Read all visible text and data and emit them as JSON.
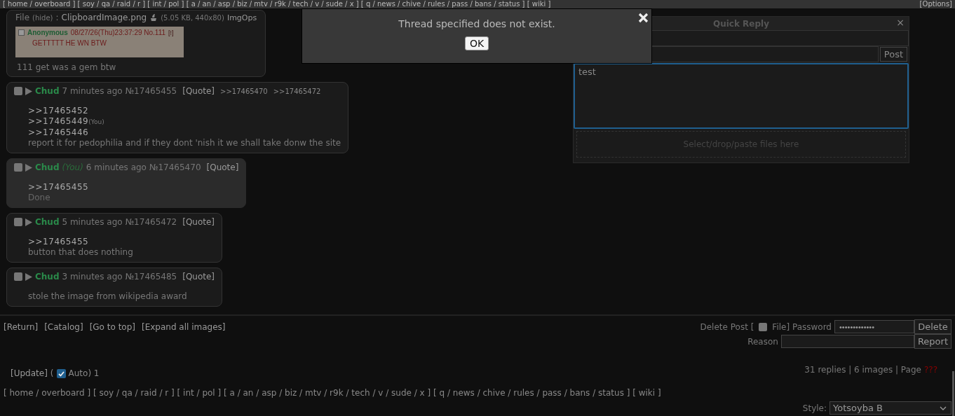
{
  "top_nav": {
    "boards": "[ home / overboard ] [ soy / qa / raid / r ] [ int / pol ] [ a / an / asp / biz / mtv / r9k / tech / v / sude / x ] [ q / news / chive / rules / pass / bans / status ] [ wiki ]",
    "options": "[Options]"
  },
  "first_post": {
    "file_label": "File",
    "hide": "(hide)",
    "colon": ":",
    "filename": "ClipboardImage.png",
    "file_meta": "(5.05 KB, 440x80)",
    "imgops": "ImgOps",
    "thumbnail": {
      "name": "Anonymous",
      "date": "08/27/26(Thu)23:37:29 No.111",
      "flag": "[!]",
      "body": "GETTTTT HE WN BTW"
    },
    "body": "111 get was a gem btw"
  },
  "posts": [
    {
      "name": "Chud",
      "highlighted": false,
      "checked": false,
      "time": "7 minutes ago",
      "number": "№17465455",
      "quote": "[Quote]",
      "backlinks": [
        ">>17465470",
        ">>17465472"
      ],
      "lines": [
        {
          "kind": "quote",
          "text": ">>17465452"
        },
        {
          "kind": "quote",
          "text": ">>17465449",
          "you": "(You)"
        },
        {
          "kind": "quote",
          "text": ">>17465446"
        },
        {
          "kind": "text",
          "text": "report it for pedophilia and if they dont 'nish it we shall take donw the site"
        }
      ]
    },
    {
      "name": "Chud",
      "you": "(You)",
      "highlighted": true,
      "checked": false,
      "time": "6 minutes ago",
      "number": "№17465470",
      "quote": "[Quote]",
      "lines": [
        {
          "kind": "quote",
          "text": ">>17465455"
        },
        {
          "kind": "text",
          "text": "Done"
        }
      ]
    },
    {
      "name": "Chud",
      "highlighted": false,
      "checked": false,
      "time": "5 minutes ago",
      "number": "№17465472",
      "quote": "[Quote]",
      "lines": [
        {
          "kind": "quote",
          "text": ">>17465455"
        },
        {
          "kind": "text",
          "text": "button that does nothing"
        }
      ]
    },
    {
      "name": "Chud",
      "highlighted": false,
      "checked": false,
      "time": "3 minutes ago",
      "number": "№17465485",
      "quote": "[Quote]",
      "lines": [
        {
          "kind": "text",
          "text": "stole the image from wikipedia award"
        }
      ]
    }
  ],
  "footer_links": [
    "[Return]",
    "[Catalog]",
    "[Go to top]",
    "[Expand all images]"
  ],
  "delete_form": {
    "delete_label": "Delete Post [",
    "file_checked": false,
    "file_label": "File] Password",
    "password": "•••••••••••••",
    "delete_button": "Delete",
    "reason_label": "Reason",
    "report_button": "Report"
  },
  "updater": {
    "update": "[Update]",
    "open": "(",
    "auto_checked": true,
    "auto_label": "Auto) 1"
  },
  "stats": {
    "text": "31 replies | 6 images | Page",
    "page": "???"
  },
  "bottom_nav": "[ home / overboard ] [ soy / qa / raid / r ] [ int / pol ] [ a / an / asp / biz / mtv / r9k / tech / v / sude / x ] [ q / news / chive / rules / pass / bans / status ] [ wiki ]",
  "style_select": {
    "label": "Style:",
    "value": "Yotsoyba B"
  },
  "quick_reply": {
    "title": "Quick Reply",
    "close": "×",
    "post_button": "Post",
    "comment": "test",
    "drop_zone": "Select/drop/paste files here"
  },
  "modal": {
    "message": "Thread specified does not exist.",
    "ok": "OK"
  }
}
